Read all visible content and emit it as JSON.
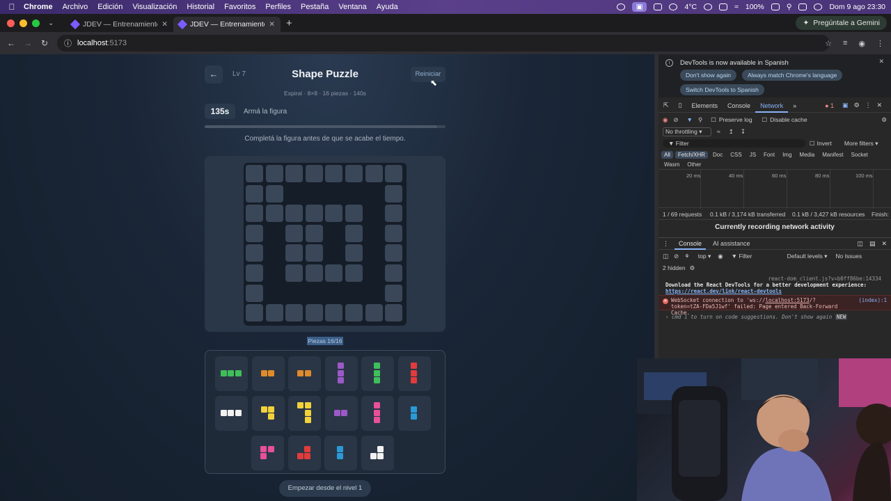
{
  "menubar": {
    "app": "Chrome",
    "items": [
      "Archivo",
      "Edición",
      "Visualización",
      "Historial",
      "Favoritos",
      "Perfiles",
      "Pestaña",
      "Ventana",
      "Ayuda"
    ],
    "temp": "4°C",
    "battery": "100%",
    "datetime": "Dom 9 ago  23:30"
  },
  "tabs": [
    {
      "title": "JDEV — Entrenamiento mental"
    },
    {
      "title": "JDEV — Entrenamiento mental"
    }
  ],
  "gemini": "Pregúntale a Gemini",
  "url": {
    "host": "localhost",
    "port": ":5173"
  },
  "game": {
    "level": "Lv 7",
    "title": "Shape Puzzle",
    "restart": "Reiniciar",
    "subtitle": "Espiral · 8×8 · 16 piezas · 140s",
    "timer": "135s",
    "hint": "Armá la figura",
    "time_remaining_fraction": 0.964,
    "instruction": "Completá la figura antes de que se acabe el tiempo.",
    "pieces_count": "Piezas 16/16",
    "start_button": "Empezar desde el nivel 1"
  },
  "board": {
    "size": 8,
    "rows": [
      "########",
      "##.....#",
      "######.#",
      "#.##.#.#",
      "#.##.#.#",
      "#.####.#",
      "#......#",
      "########"
    ]
  },
  "pieces": [
    {
      "color": "#3fbf5a",
      "cells": [
        [
          0,
          0
        ],
        [
          1,
          0
        ],
        [
          2,
          0
        ]
      ]
    },
    {
      "color": "#e08a2a",
      "cells": [
        [
          0,
          0
        ],
        [
          1,
          0
        ]
      ]
    },
    {
      "color": "#e08a2a",
      "cells": [
        [
          0,
          0
        ],
        [
          1,
          0
        ]
      ]
    },
    {
      "color": "#9b59c6",
      "cells": [
        [
          0,
          0
        ],
        [
          0,
          1
        ],
        [
          0,
          2
        ]
      ]
    },
    {
      "color": "#3fbf5a",
      "cells": [
        [
          0,
          0
        ],
        [
          0,
          1
        ],
        [
          0,
          2
        ]
      ]
    },
    {
      "color": "#e23b3b",
      "cells": [
        [
          0,
          0
        ],
        [
          0,
          1
        ],
        [
          0,
          2
        ]
      ]
    },
    {
      "color": "#f2f2f2",
      "cells": [
        [
          0,
          0
        ],
        [
          1,
          0
        ],
        [
          2,
          0
        ]
      ]
    },
    {
      "color": "#f2d23a",
      "cells": [
        [
          0,
          0
        ],
        [
          1,
          0
        ],
        [
          1,
          1
        ]
      ]
    },
    {
      "color": "#f2d23a",
      "cells": [
        [
          0,
          0
        ],
        [
          1,
          0
        ],
        [
          1,
          1
        ],
        [
          1,
          2
        ]
      ]
    },
    {
      "color": "#9b59c6",
      "cells": [
        [
          0,
          0
        ],
        [
          1,
          0
        ]
      ]
    },
    {
      "color": "#e8509a",
      "cells": [
        [
          0,
          0
        ],
        [
          0,
          1
        ],
        [
          0,
          2
        ]
      ]
    },
    {
      "color": "#2a9ad6",
      "cells": [
        [
          0,
          0
        ],
        [
          0,
          1
        ]
      ]
    },
    {
      "color": "#e8509a",
      "cells": [
        [
          0,
          0
        ],
        [
          1,
          0
        ],
        [
          0,
          1
        ]
      ]
    },
    {
      "color": "#e23b3b",
      "cells": [
        [
          1,
          0
        ],
        [
          0,
          1
        ],
        [
          1,
          1
        ]
      ]
    },
    {
      "color": "#2a9ad6",
      "cells": [
        [
          0,
          0
        ],
        [
          0,
          1
        ]
      ]
    },
    {
      "color": "#f2f2f2",
      "cells": [
        [
          1,
          0
        ],
        [
          0,
          1
        ],
        [
          1,
          1
        ]
      ]
    }
  ],
  "devtools": {
    "notice": "DevTools is now available in Spanish",
    "btn_dont_show": "Don't show again",
    "btn_match": "Always match Chrome's language",
    "btn_switch": "Switch DevTools to Spanish",
    "tabs": [
      "Elements",
      "Console",
      "Network"
    ],
    "errors": "1",
    "preserve_log": "Preserve log",
    "disable_cache": "Disable cache",
    "throttling": "No throttling",
    "filter": "Filter",
    "invert": "Invert",
    "more_filters": "More filters",
    "type_filters": [
      "All",
      "Fetch/XHR",
      "Doc",
      "CSS",
      "JS",
      "Font",
      "Img",
      "Media",
      "Manifest",
      "Socket",
      "Wasm",
      "Other"
    ],
    "ticks": [
      "20 ms",
      "40 ms",
      "60 ms",
      "80 ms",
      "100 ms"
    ],
    "requests": "1 / 69 requests",
    "transferred": "0.1 kB / 3,174 kB transferred",
    "resources": "0.1 kB / 3,427 kB resources",
    "finish": "Finish:",
    "recording": "Currently recording network activity",
    "drawer_tabs": [
      "Console",
      "AI assistance"
    ],
    "context": "top",
    "console_filter": "Filter",
    "levels": "Default levels",
    "issues": "No Issues",
    "hidden": "2 hidden",
    "log_source": "react-dom_client.js?v=b0ff86be:14334",
    "log_msg": "Download the React DevTools for a better development experience:",
    "log_link": "https://react.dev/link/react-devtools",
    "err_msg_a": "WebSocket connection to 'ws://",
    "err_link": "localhost:5173",
    "err_msg_b": "/?token=tZA-FDa5J1wf' failed: Page entered Back-Forward Cache.",
    "err_src": "(index):1",
    "suggest": "cmd  i  to turn on code suggestions. Don't show again",
    "new_badge": "NEW"
  }
}
